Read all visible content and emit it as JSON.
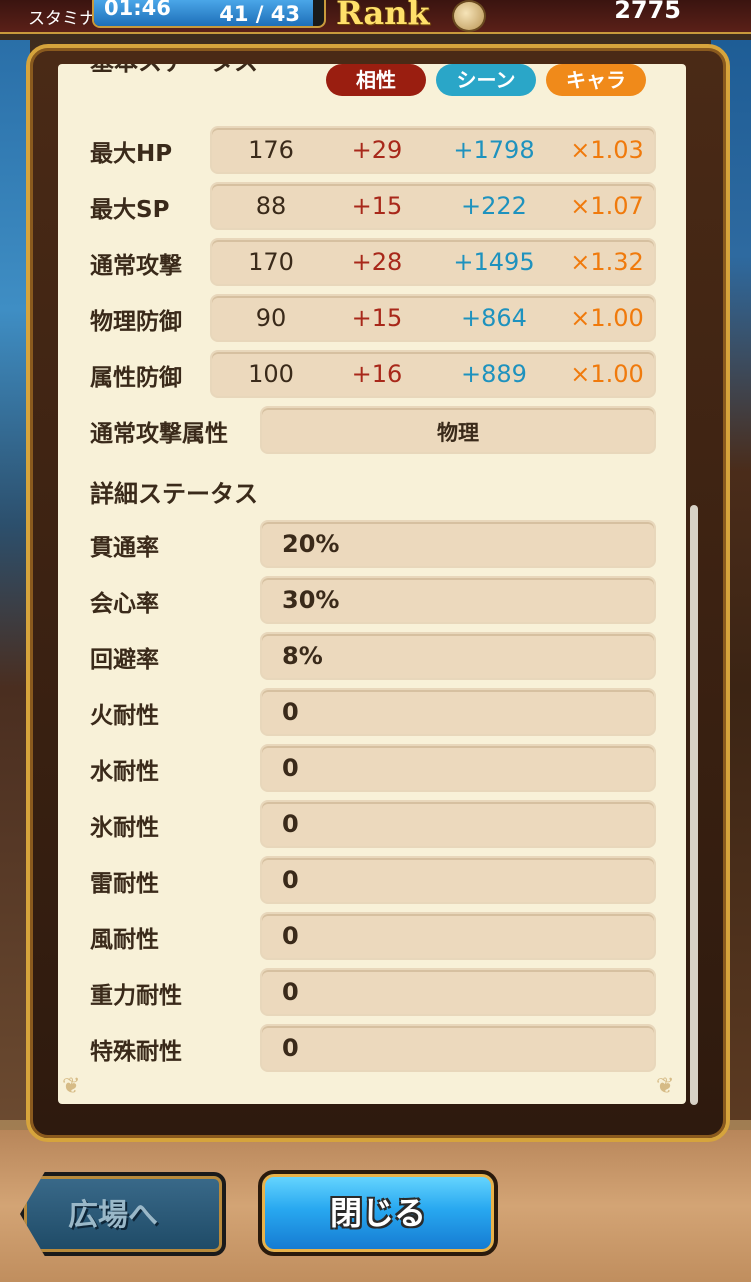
{
  "topbar": {
    "stamina_label": "スタミナ",
    "stamina_timer": "01:46",
    "stamina_count": "41 /  43",
    "stamina_fraction": 0.95,
    "rank_label": "Rank",
    "coin_count": "2775"
  },
  "basic": {
    "title": "基本ステータス",
    "tags": {
      "aisho": "相性",
      "scene": "シーン",
      "chara": "キャラ"
    },
    "rows": [
      {
        "label": "最大HP",
        "base": "176",
        "aisho": "+29",
        "scene": "+1798",
        "chara": "×1.03"
      },
      {
        "label": "最大SP",
        "base": "88",
        "aisho": "+15",
        "scene": "+222",
        "chara": "×1.07"
      },
      {
        "label": "通常攻撃",
        "base": "170",
        "aisho": "+28",
        "scene": "+1495",
        "chara": "×1.32"
      },
      {
        "label": "物理防御",
        "base": "90",
        "aisho": "+15",
        "scene": "+864",
        "chara": "×1.00"
      },
      {
        "label": "属性防御",
        "base": "100",
        "aisho": "+16",
        "scene": "+889",
        "chara": "×1.00"
      }
    ],
    "attack_attr_label": "通常攻撃属性",
    "attack_attr_value": "物理"
  },
  "detail": {
    "title": "詳細ステータス",
    "rows": [
      {
        "label": "貫通率",
        "value": "20%"
      },
      {
        "label": "会心率",
        "value": "30%"
      },
      {
        "label": "回避率",
        "value": "8%"
      },
      {
        "label": "火耐性",
        "value": "0"
      },
      {
        "label": "水耐性",
        "value": "0"
      },
      {
        "label": "氷耐性",
        "value": "0"
      },
      {
        "label": "雷耐性",
        "value": "0"
      },
      {
        "label": "風耐性",
        "value": "0"
      },
      {
        "label": "重力耐性",
        "value": "0"
      },
      {
        "label": "特殊耐性",
        "value": "0"
      }
    ]
  },
  "buttons": {
    "plaza": "広場へ",
    "close": "閉じる"
  },
  "colors": {
    "aisho": "#9a1e10",
    "scene": "#2aa6c8",
    "chara": "#f08a1a",
    "frame_gold": "#d6a43c"
  }
}
